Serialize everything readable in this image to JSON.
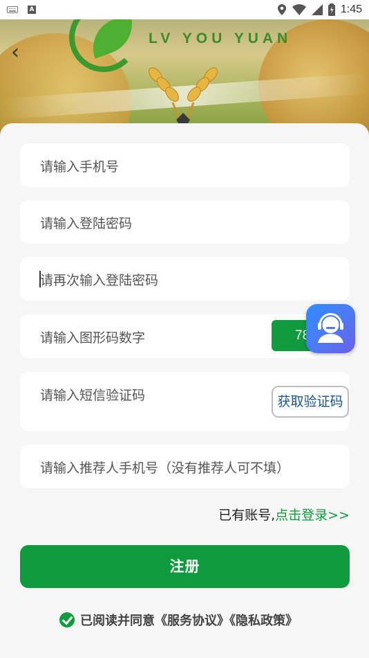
{
  "status_bar": {
    "time": "1:45"
  },
  "banner": {
    "logo_text": "LV YOU YUAN",
    "back_glyph": "‹"
  },
  "form": {
    "phone_placeholder": "请输入手机号",
    "password_placeholder": "请输入登陆密码",
    "password_confirm_placeholder": "请再次输入登陆密码",
    "captcha_placeholder": "请输入图形码数字",
    "captcha_value": "78",
    "sms_placeholder": "请输入短信验证码",
    "get_code_label": "获取验证码",
    "referrer_placeholder": "请输入推荐人手机号（没有推荐人可不填）"
  },
  "login_hint": {
    "prefix": "已有账号,",
    "link": "点击登录>>"
  },
  "register_label": "注册",
  "agreement": {
    "text": "已阅读并同意《服务协议》《隐私政策》",
    "checked": true
  },
  "colors": {
    "accent": "#0f9a3d",
    "link": "#17568f"
  },
  "icons": [
    "keyboard-icon",
    "a-icon",
    "location-icon",
    "wifi-icon",
    "signal-icon",
    "battery-icon",
    "back-arrow-icon",
    "check-icon",
    "customer-service-icon"
  ]
}
